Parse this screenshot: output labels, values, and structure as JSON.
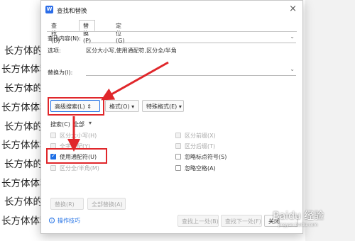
{
  "document": {
    "lines": [
      "长方体的",
      "长方体体积",
      "长方体的",
      "长方体体积",
      "长方体的",
      "长方体体积",
      "长方体的",
      "长方体体积",
      "长方体的",
      "长方体体积"
    ]
  },
  "dialog": {
    "title": "查找和替换",
    "app_icon": "W",
    "close": "×",
    "tabs": [
      "查找(D)",
      "替换(P)",
      "定位(G)"
    ],
    "find_label": "查找内容(N):",
    "options_label": "选项:",
    "options_value": "区分大小写,使用通配符,区分全/半角",
    "replace_label": "替换为(I):",
    "advanced_button": "高级搜索(L) ⇕",
    "format_button": "格式(O) ▾",
    "special_button": "特殊格式(E) ▾",
    "search_label": "搜索(C)",
    "search_value": "全部",
    "checkboxes_left": [
      {
        "label": "区分大小写(H)",
        "checked": true,
        "disabled": true
      },
      {
        "label": "全字匹配(Y)",
        "checked": false,
        "disabled": true
      },
      {
        "label": "使用通配符(U)",
        "checked": true,
        "disabled": false
      },
      {
        "label": "区分全/半角(M)",
        "checked": true,
        "disabled": true
      }
    ],
    "checkboxes_right": [
      {
        "label": "区分前缀(X)",
        "checked": false,
        "disabled": true
      },
      {
        "label": "区分后缀(T)",
        "checked": false,
        "disabled": true
      },
      {
        "label": "忽略标点符号(S)",
        "checked": false,
        "disabled": false
      },
      {
        "label": "忽略空格(A)",
        "checked": false,
        "disabled": false
      }
    ],
    "replace_button": "替换(R)",
    "replace_all_button": "全部替换(A)",
    "tips_link": "操作技巧",
    "find_prev_button": "查找上一处(B)",
    "find_next_button": "查找下一处(F)",
    "close_button": "关闭"
  },
  "watermark": {
    "text": "Baidu 经验",
    "sub": "jingyan.baidu.com"
  },
  "colors": {
    "accent": "#1f6fe5",
    "annotation_red": "#e0272b"
  }
}
